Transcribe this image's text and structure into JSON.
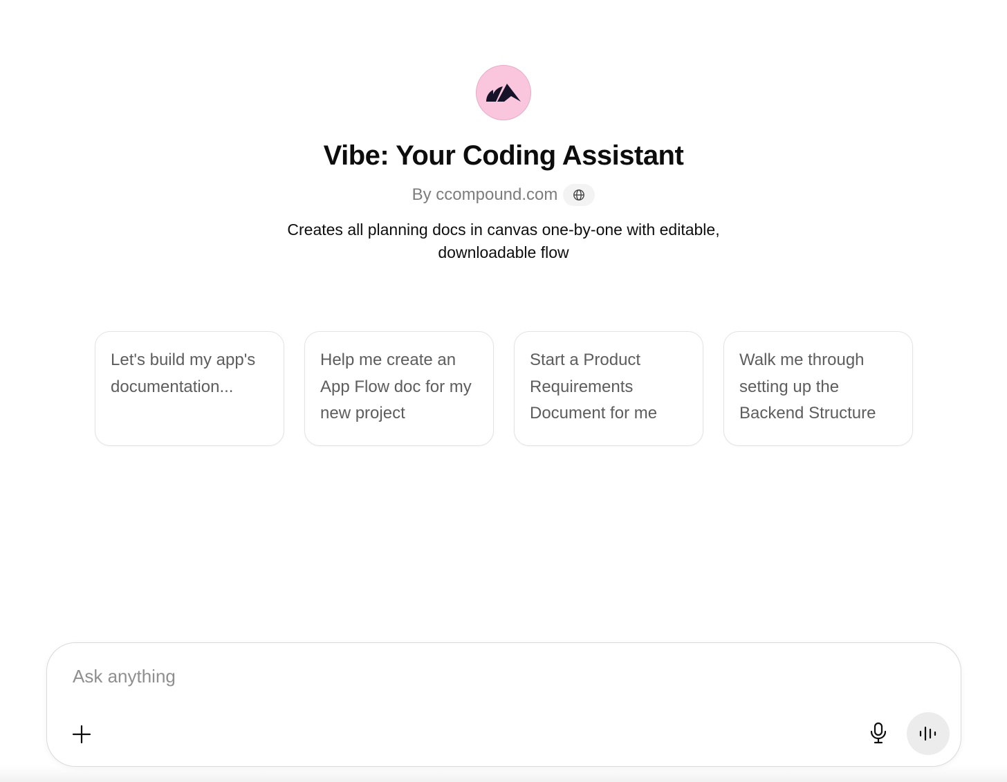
{
  "gpt": {
    "logo": "vibe-logo-icon",
    "title": "Vibe: Your Coding Assistant",
    "author": "By ccompound.com",
    "globe_icon": "globe-icon",
    "description": "Creates all planning docs in canvas one-by-one with editable, downloadable flow",
    "avatar_color": "#f9c6dd"
  },
  "suggestions": [
    {
      "label": "Let's build my app's documentation..."
    },
    {
      "label": "Help me create an App Flow doc for my new project"
    },
    {
      "label": "Start a Product Requirements Document for me"
    },
    {
      "label": "Walk me through setting up the Backend Structure"
    }
  ],
  "composer": {
    "placeholder": "Ask anything",
    "value": "",
    "add_icon": "plus-icon",
    "mic_icon": "microphone-icon",
    "voice_icon": "voice-mode-icon"
  }
}
